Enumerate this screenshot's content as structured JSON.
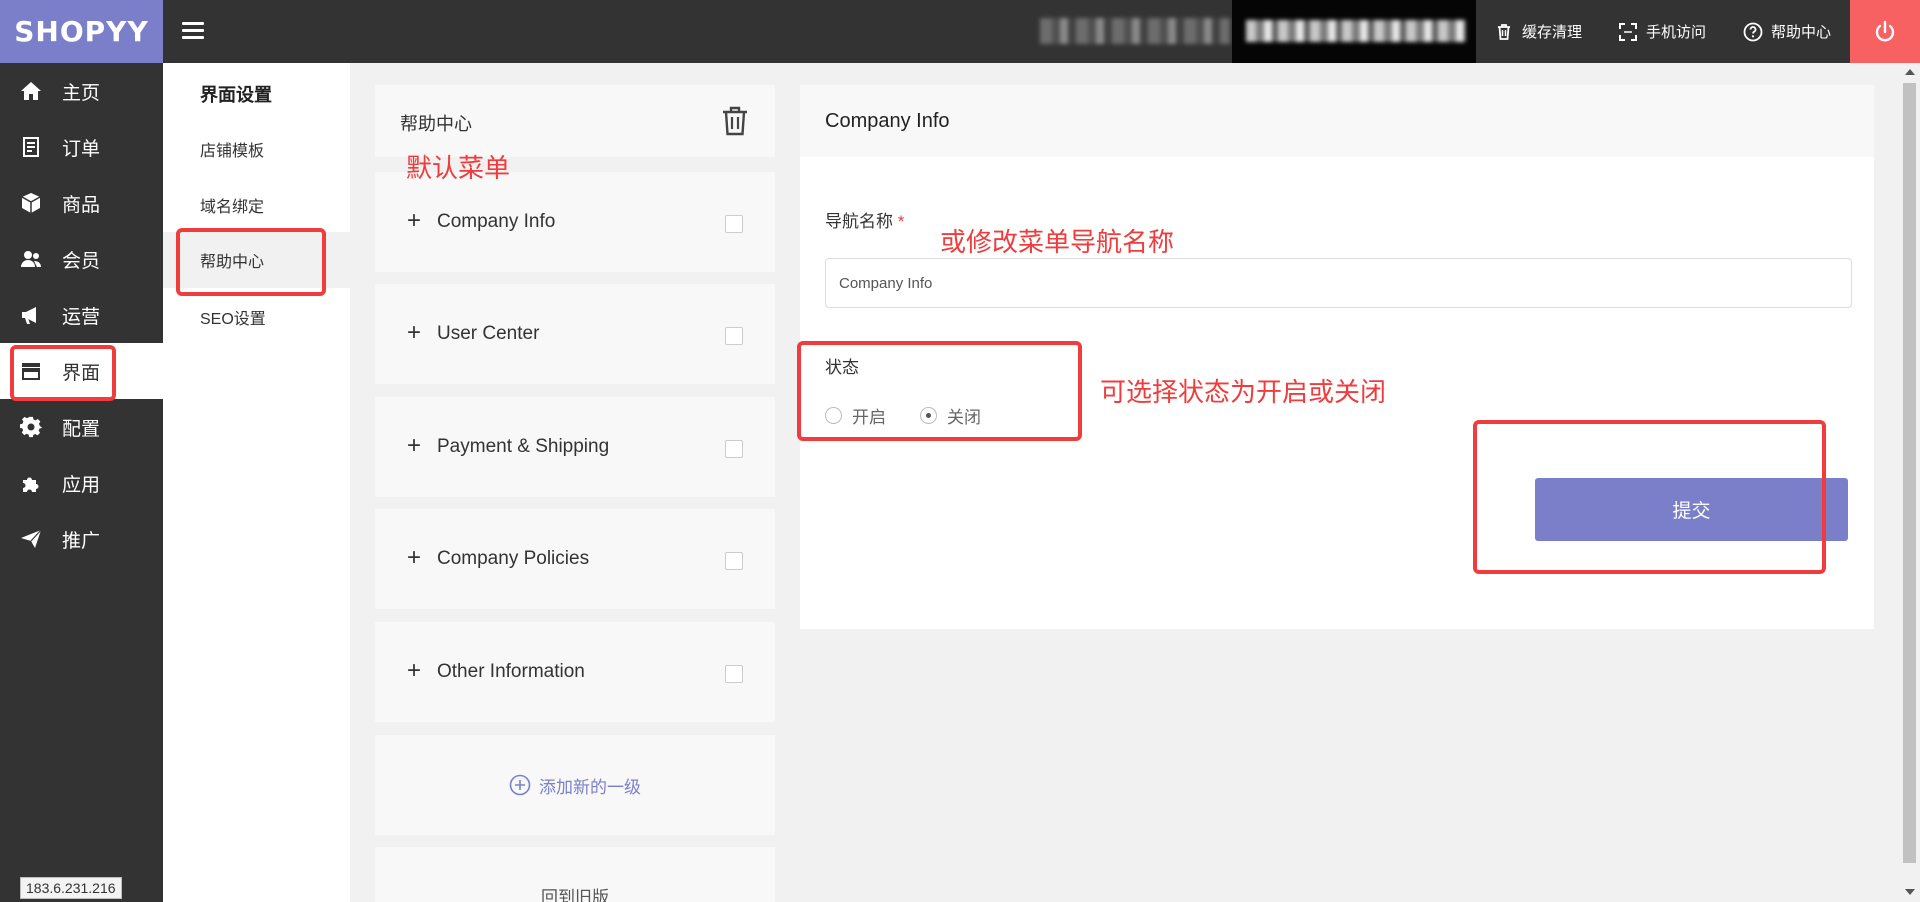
{
  "brand": {
    "logo": "SHOPYY",
    "accent_color": "#7b7fca",
    "power_color": "#f86161"
  },
  "topbar": {
    "cache_clear": "缓存清理",
    "mobile_access": "手机访问",
    "help_center": "帮助中心"
  },
  "sidebar": {
    "items": [
      {
        "label": "主页",
        "icon": "home-icon"
      },
      {
        "label": "订单",
        "icon": "order-icon"
      },
      {
        "label": "商品",
        "icon": "product-box-icon"
      },
      {
        "label": "会员",
        "icon": "members-icon"
      },
      {
        "label": "运营",
        "icon": "megaphone-icon"
      },
      {
        "label": "界面",
        "icon": "storefront-icon",
        "active": true
      },
      {
        "label": "配置",
        "icon": "gear-icon"
      },
      {
        "label": "应用",
        "icon": "puzzle-icon"
      },
      {
        "label": "推广",
        "icon": "send-icon"
      }
    ],
    "ip": "183.6.231.216"
  },
  "subsidebar": {
    "title": "界面设置",
    "items": [
      {
        "label": "店铺模板"
      },
      {
        "label": "域名绑定"
      },
      {
        "label": "帮助中心",
        "active": true
      },
      {
        "label": "SEO设置"
      }
    ]
  },
  "menu": {
    "title": "帮助中心",
    "items": [
      {
        "label": "Company Info"
      },
      {
        "label": "User Center"
      },
      {
        "label": "Payment & Shipping"
      },
      {
        "label": "Company Policies"
      },
      {
        "label": "Other Information"
      }
    ],
    "add_label": "添加新的一级",
    "old_version": "回到旧版"
  },
  "form": {
    "title": "Company Info",
    "nav_name_label": "导航名称",
    "required_mark": "*",
    "nav_name_value": "Company Info",
    "status_label": "状态",
    "status_options": [
      "开启",
      "关闭"
    ],
    "status_selected": "关闭",
    "submit_label": "提交"
  },
  "annotations": {
    "default_menu": "默认菜单",
    "rename_hint": "或修改菜单导航名称",
    "status_hint": "可选择状态为开启或关闭"
  }
}
